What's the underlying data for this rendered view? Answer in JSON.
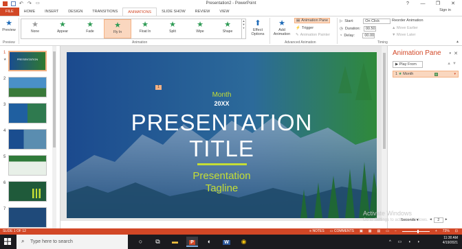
{
  "window": {
    "title": "Presentation2 - PowerPoint",
    "controls": [
      "?",
      "—",
      "❐",
      "✕"
    ]
  },
  "ribbon": {
    "tabs": [
      "FILE",
      "HOME",
      "INSERT",
      "DESIGN",
      "TRANSITIONS",
      "ANIMATIONS",
      "SLIDE SHOW",
      "REVIEW",
      "VIEW"
    ],
    "active_tab": "ANIMATIONS",
    "sign_in": "Sign in",
    "preview": {
      "label": "Preview",
      "group": "Preview"
    },
    "animations": [
      "None",
      "Appear",
      "Fade",
      "Fly In",
      "Float In",
      "Split",
      "Wipe",
      "Shape"
    ],
    "selected_animation": "Fly In",
    "animation_group": "Animation",
    "effect_options": "Effect Options",
    "add_animation": "Add Animation",
    "animation_pane_btn": "Animation Pane",
    "trigger": "Trigger",
    "animation_painter": "Animation Painter",
    "advanced_group": "Advanced Animation",
    "timing": {
      "start_label": "Start:",
      "start_value": "On Click",
      "duration_label": "Duration:",
      "duration_value": "00.50",
      "delay_label": "Delay:",
      "delay_value": "00.00",
      "group": "Timing"
    },
    "reorder": {
      "title": "Reorder Animation",
      "earlier": "Move Earlier",
      "later": "Move Later"
    }
  },
  "thumbnails": {
    "numbers": [
      "1",
      "2",
      "3",
      "4",
      "5",
      "6",
      "7"
    ],
    "selected": 0
  },
  "slide": {
    "month": "Month",
    "year": "20XX",
    "title_line1": "PRESENTATION",
    "title_line2": "TITLE",
    "tagline_line1": "Presentation",
    "tagline_line2": "Tagline",
    "anim_badge": "1",
    "colors": {
      "accent": "#c5de35",
      "bg_left": "#1a4d8f",
      "bg_right": "#2f7a2f"
    }
  },
  "pane": {
    "title": "Animation Pane",
    "play_from": "Play From",
    "item_number": "1",
    "item_label": "Month",
    "seconds": "Seconds",
    "zoom_box": "2",
    "watermark_line1": "Activate Windows",
    "watermark_line2": "Go to Settings to activate Windows."
  },
  "status": {
    "slide_info": "SLIDE 1 OF 12",
    "notes": "NOTES",
    "comments": "COMMENTS",
    "zoom": "73%"
  },
  "taskbar": {
    "search_placeholder": "Type here to search",
    "time": "11:30 AM",
    "date": "4/19/2021",
    "icons": [
      "task-view-icon",
      "file-explorer-icon",
      "powerpoint-icon",
      "photos-icon",
      "word-icon",
      "chrome-icon"
    ]
  }
}
